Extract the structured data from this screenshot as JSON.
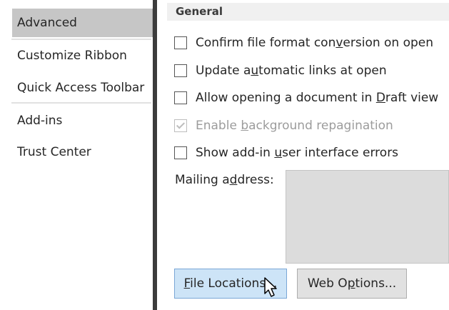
{
  "sidebar": {
    "items": [
      {
        "label": "Advanced",
        "selected": true
      },
      {
        "label": "Customize Ribbon",
        "selected": false
      },
      {
        "label": "Quick Access Toolbar",
        "selected": false
      },
      {
        "label": "Add-ins",
        "selected": false
      },
      {
        "label": "Trust Center",
        "selected": false
      }
    ]
  },
  "general": {
    "header": "General",
    "options": [
      {
        "pre": "Confirm file format con",
        "key": "v",
        "post": "ersion on open",
        "checked": false,
        "disabled": false
      },
      {
        "pre": "Update a",
        "key": "u",
        "post": "tomatic links at open",
        "checked": false,
        "disabled": false
      },
      {
        "pre": "Allow opening a document in ",
        "key": "D",
        "post": "raft view",
        "checked": false,
        "disabled": false
      },
      {
        "pre": "Enable ",
        "key": "b",
        "post": "ackground repagination",
        "checked": true,
        "disabled": true
      },
      {
        "pre": "Show add-in ",
        "key": "u",
        "post": "ser interface errors",
        "checked": false,
        "disabled": false
      }
    ],
    "mailing": {
      "pre": "Mailing a",
      "key": "d",
      "post": "dress:",
      "value": ""
    }
  },
  "buttons": {
    "file_locations": {
      "pre": "",
      "key": "F",
      "post": "ile Locations..."
    },
    "web_options": {
      "pre": "Web O",
      "key": "p",
      "post": "tions..."
    }
  },
  "colors": {
    "selected_nav": "#c6c6c6",
    "splitter": "#3c3c3c",
    "focus_button": "#cde4f7"
  }
}
